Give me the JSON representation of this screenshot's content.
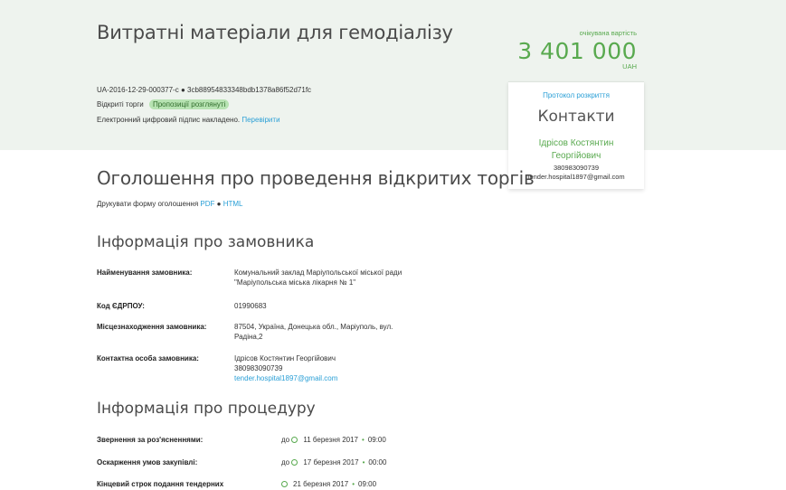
{
  "tender": {
    "title": "Витратні матеріали для гемодіалізу",
    "id": "UA-2016-12-29-000377-c",
    "hash": "3cb88954833348bdb1378a86f52d71fc",
    "type": "Відкриті торги",
    "status": "Пропозиції розглянуті",
    "signature_text": "Електронний цифровий підпис накладено.",
    "verify_link": "Перевірити"
  },
  "value": {
    "label": "очікувана вартість",
    "amount": "3 401 000",
    "currency": "UAH"
  },
  "contacts": {
    "protocol_link": "Протокол розкриття",
    "title": "Контакти",
    "name": "Ідрісов Костянтин Георгійович",
    "phone": "380983090739",
    "email": "tender.hospital1897@gmail.com"
  },
  "announcement": {
    "title": "Оголошення про проведення відкритих торгів",
    "print_label": "Друкувати форму оголошення",
    "pdf": "PDF",
    "html": "HTML"
  },
  "customer": {
    "section_title": "Інформація про замовника",
    "rows": [
      {
        "label": "Найменування замовника:",
        "value": "Комунальний заклад Маріупольської міської ради \"Маріупольська міська лікарня № 1\""
      },
      {
        "label": "Код ЄДРПОУ:",
        "value": "01990683"
      },
      {
        "label": "Місцезнаходження замовника:",
        "value": "87504, Україна, Донецька обл., Маріуполь, вул. Радіна,2"
      },
      {
        "label": "Контактна особа замовника:",
        "value": "Ідрісов Костянтин Георгійович",
        "phone": "380983090739",
        "email": "tender.hospital1897@gmail.com"
      }
    ]
  },
  "procedure": {
    "section_title": "Інформація про процедуру",
    "rows": [
      {
        "label": "Звернення за роз'ясненнями:",
        "prefix": "до",
        "date": "11 березня 2017",
        "time": "09:00"
      },
      {
        "label": "Оскарження умов закупівлі:",
        "prefix": "до",
        "date": "17 березня 2017",
        "time": "00:00"
      },
      {
        "label": "Кінцевий строк подання тендерних",
        "prefix": "",
        "date": "21 березня 2017",
        "time": "09:00"
      }
    ]
  },
  "colors": {
    "accent_green": "#58a94e",
    "link_blue": "#2a9fd6",
    "hero_bg": "#eef3ee",
    "badge_bg": "#b7e3b2"
  }
}
